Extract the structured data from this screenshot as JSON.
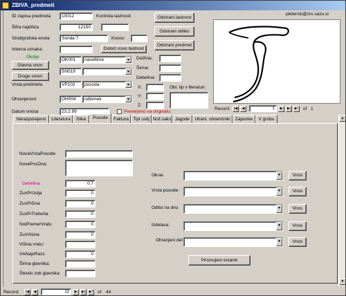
{
  "window": {
    "title": "ZBIVA_predmeti",
    "user": "pleterski@zrc-sazu.si"
  },
  "form": {
    "id_label": "ID zapisa predmeta",
    "id_value": "10012",
    "kontrola_label": "Kontrola lastnosti",
    "sifra_label": "Šifra najdišča",
    "sifra_value": "12150",
    "strat_label": "Stratigrafska enota",
    "strat_value": "Sonda 7",
    "kosov_label": "Kosov:",
    "interna_label": "Interna oznaka:",
    "dolocni_label": "Določi novo lastnost",
    "okolje_label": "Okolje",
    "glavna_label": "Glavna snov:",
    "glavna_code": "OK001",
    "glavna_value": "naselbina",
    "druge_label": "Druge snovi:",
    "druge_code": "SN019",
    "vrsta_label": "Vrsta predmeta",
    "vrsta_code": "VP102",
    "vrsta_value": "posoda",
    "ohranjenost_label": "Ohranjenost",
    "ohranjenost_code": "OH004",
    "ohranjenost_value": "odlomek",
    "datum_label": "Datum vnosa",
    "datum_value": "23.2.99",
    "preverjeno_label": "Preverjeno na originalu:",
    "dolzina_label": "Dolžina:",
    "sirina_label": "Širina:",
    "debelina_label": "Debelina:",
    "x_label": "X:",
    "y_label": "Y:",
    "z_label": "Z:",
    "obl_label": "Obl. tip v literaturi:"
  },
  "buttons": {
    "odstrani_lastnost": "Odstrani lastnost",
    "odstrani_obliko": "Odstrani obliko",
    "odstrani_predmet": "Odstrani predmet",
    "prisvojeni_ostanki": "Prismojeni ostanki",
    "vnos": "Vnos"
  },
  "image_nav": {
    "record_label": "Record:",
    "current": "1",
    "of_label": "of",
    "total": "1"
  },
  "tabs": [
    "Nerazporejeno",
    "Literatura",
    "Slika",
    "Posode",
    "Faktura",
    "Tipi ustij",
    "Nož.saks",
    "Jagode",
    "Ulrani. obsenčniki",
    "Zaponke",
    "V grobu"
  ],
  "active_tab": "Posode",
  "posode": {
    "nova_vrsta_label": "NovaVrstaPosode",
    "nove_pos_dna_label": "NovePosDna:",
    "debelina_label": "Debelina",
    "debelina_value": "0,7",
    "zun_pr_ustja_label": "ZunPrUstja",
    "zun_pr_ustja_value": "0",
    "zun_pr_dna_label": "ZunPrDna",
    "zun_pr_dna_value": "0",
    "zun_pr_trebuha_label": "ZunPrTrebuha",
    "zun_pr_trebuha_value": "0",
    "not_premer_vratu_label": "NotPremerVratu",
    "not_premer_vratu_value": "0",
    "zun_visina_label": "ZunVisina",
    "zun_visina_value": "0",
    "visina_vratu_label": "Višina vratu:",
    "vis_najv_razs_label": "VisNajvRazs",
    "vis_najv_razs_value": "0",
    "sirina_glavnika_label": "Širina glavnika:",
    "stevilo_zob_label": "Število zob glavnika:",
    "okras_label": "Okras",
    "vrsta_posode_label": "Vrsta posode:",
    "odtisi_label": "Odtisi na dnu",
    "izdelava_label": "Izdelava:",
    "ohranjeni_del_label": "Ohranjeni del"
  },
  "record_nav": {
    "record_label": "Record:",
    "current": "11",
    "of_label": "of",
    "total": "44"
  }
}
